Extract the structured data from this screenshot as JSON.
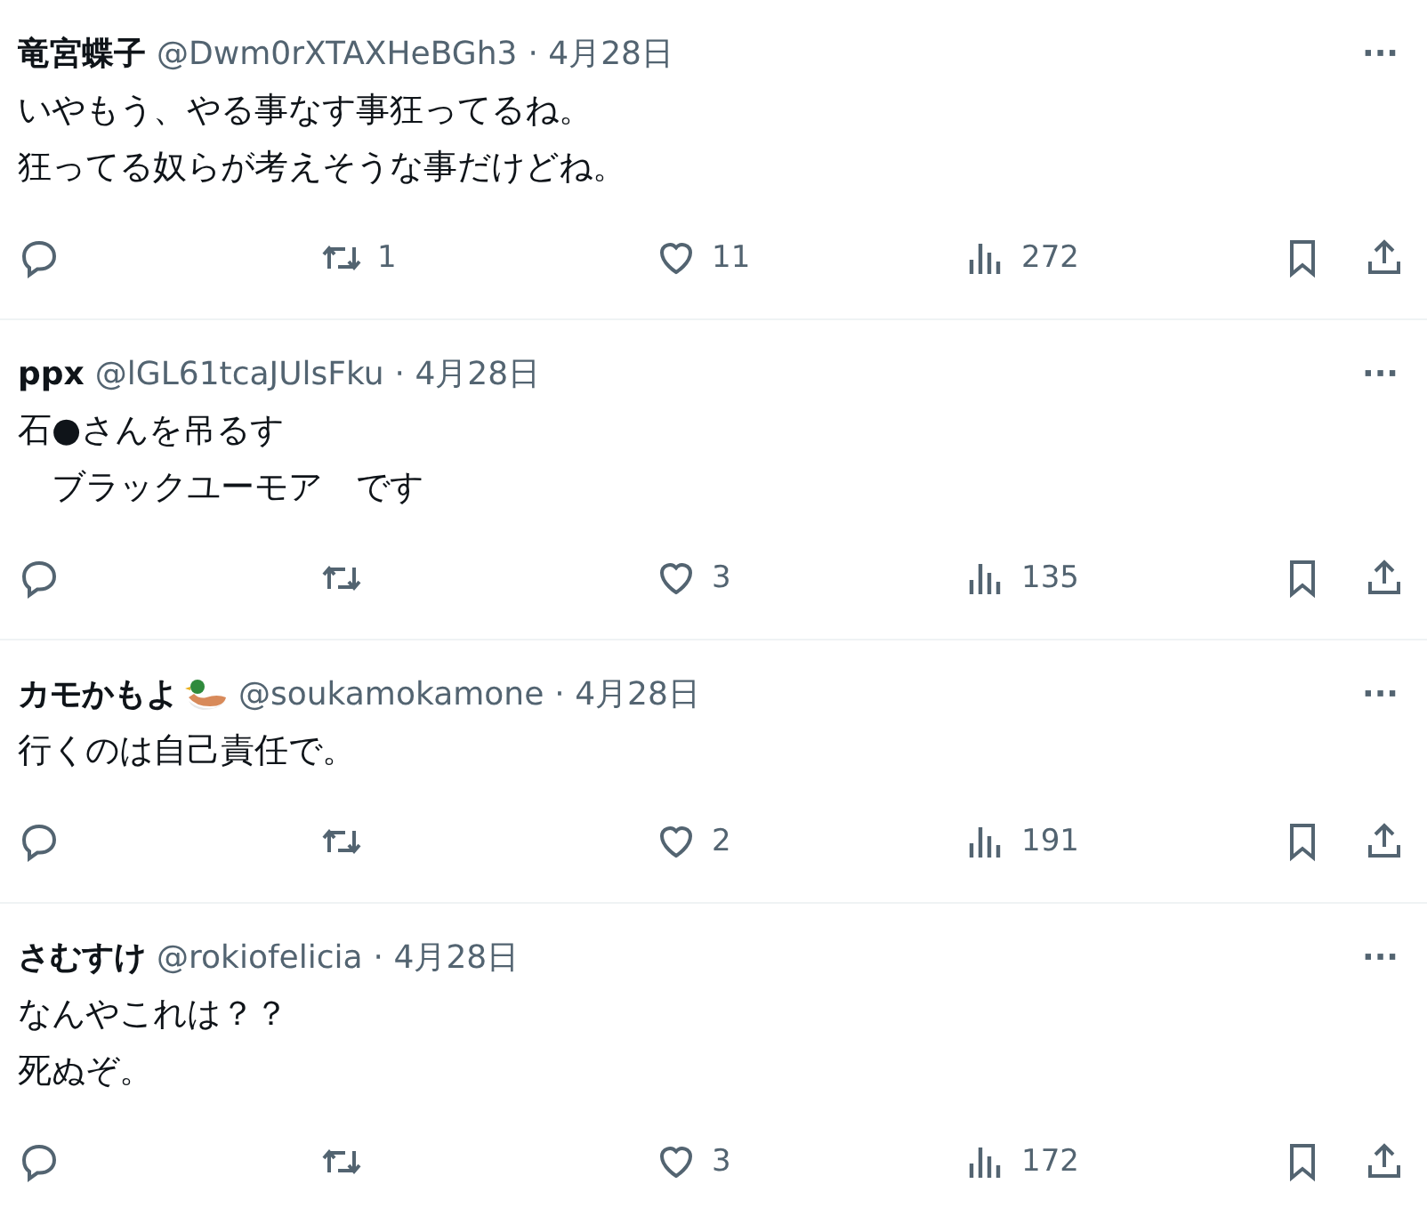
{
  "tweets": [
    {
      "name": "竜宮蝶子",
      "has_badge_icon": false,
      "handle": "@Dwm0rXTAXHeBGh3",
      "date": "· 4月28日",
      "more": "···",
      "lines": [
        "いやもう、やる事なす事狂ってるね。",
        "狂ってる奴らが考えそうな事だけどね。"
      ],
      "retweets": "1",
      "likes": "11",
      "views": "272"
    },
    {
      "name": "ppx",
      "has_badge_icon": false,
      "handle": "@lGL61tcaJUlsFku",
      "date": "· 4月28日",
      "more": "···",
      "lines": [
        "石●さんを吊るす",
        "　ブラックユーモア　です"
      ],
      "likes": "3",
      "views": "135"
    },
    {
      "name": "カモかもよ",
      "has_badge_icon": true,
      "handle": "@soukamokamone",
      "date": "· 4月28日",
      "more": "···",
      "lines": [
        "行くのは自己責任で。"
      ],
      "likes": "2",
      "views": "191"
    },
    {
      "name": "さむすけ",
      "has_badge_icon": false,
      "handle": "@rokiofelicia",
      "date": "· 4月28日",
      "more": "···",
      "lines": [
        "なんやこれは？？",
        "死ぬぞ。"
      ],
      "likes": "3",
      "views": "172"
    }
  ]
}
